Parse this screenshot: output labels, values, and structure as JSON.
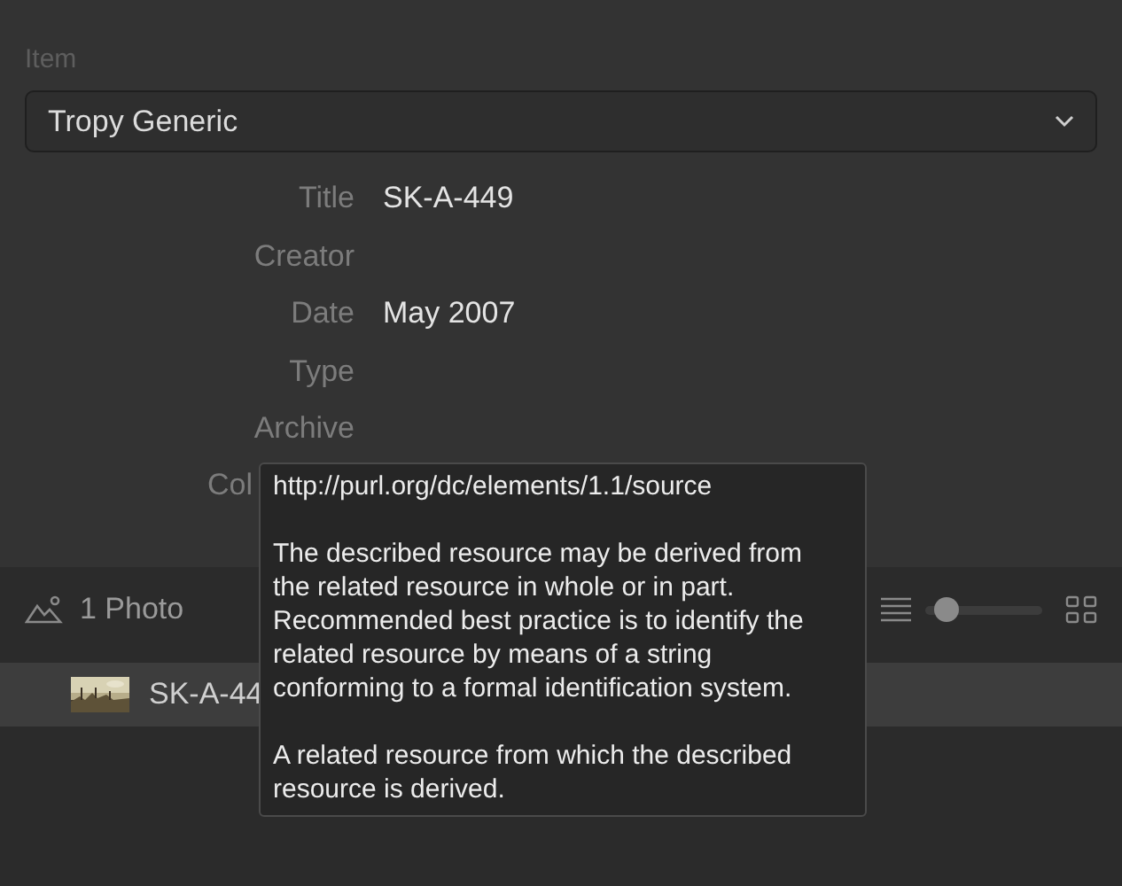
{
  "template": {
    "label": "Item",
    "value": "Tropy Generic"
  },
  "fields": [
    {
      "label": "Title",
      "value": "SK-A-449"
    },
    {
      "label": "Creator"
    },
    {
      "label": "Date",
      "value": "May 2007"
    },
    {
      "label": "Type"
    },
    {
      "label": "Archive"
    },
    {
      "label": "Col",
      "cut": true
    }
  ],
  "photos": {
    "count": "1 Photo",
    "zoom": {
      "level": 0.1
    },
    "items": [
      {
        "title": "SK-A-44",
        "selected": true
      }
    ]
  },
  "tooltip": {
    "uri": "http://purl.org/dc/elements/1.1/source",
    "paragraphs": [
      "The described resource may be derived from the related resource in whole or in part. Recommended best practice is to identify the related resource by means of a string conforming to a formal identification system.",
      "A related resource from which the described resource is derived."
    ]
  }
}
